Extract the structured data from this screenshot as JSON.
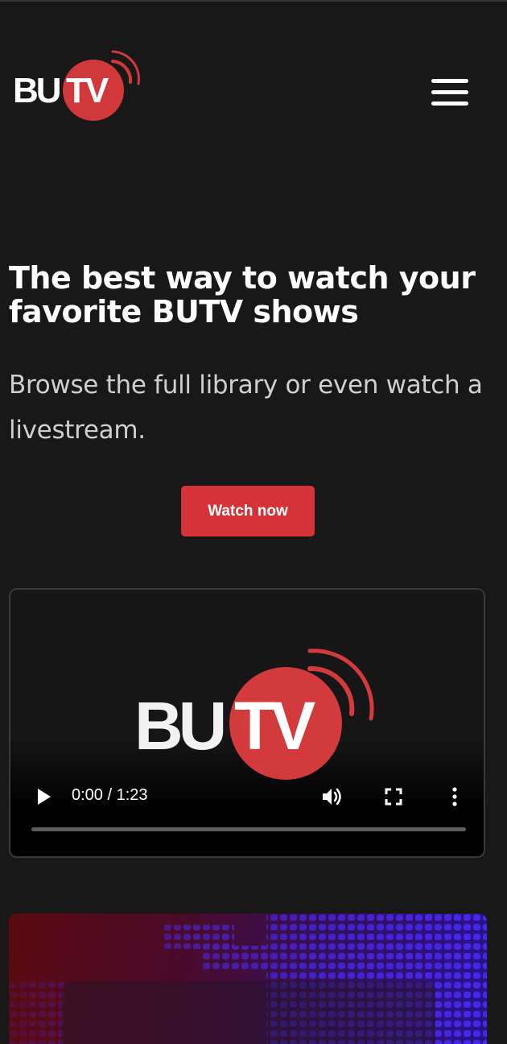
{
  "header": {
    "logo_text_left": "BU",
    "logo_text_right": "TV",
    "menu_icon": "hamburger-menu-icon"
  },
  "hero": {
    "title": "The best way to watch your favorite BUTV shows",
    "subtitle": "Browse the full library or even watch a livestream.",
    "cta_label": "Watch now"
  },
  "video": {
    "logo_text_left": "BU",
    "logo_text_right": "TV",
    "time_display": "0:00 / 1:23",
    "icons": [
      "play-icon",
      "volume-icon",
      "fullscreen-icon",
      "more-options-icon"
    ],
    "progress": 0
  },
  "colors": {
    "background": "#181818",
    "accent": "#d43338",
    "text": "#ffffff",
    "subtext": "#cfcfcf"
  }
}
